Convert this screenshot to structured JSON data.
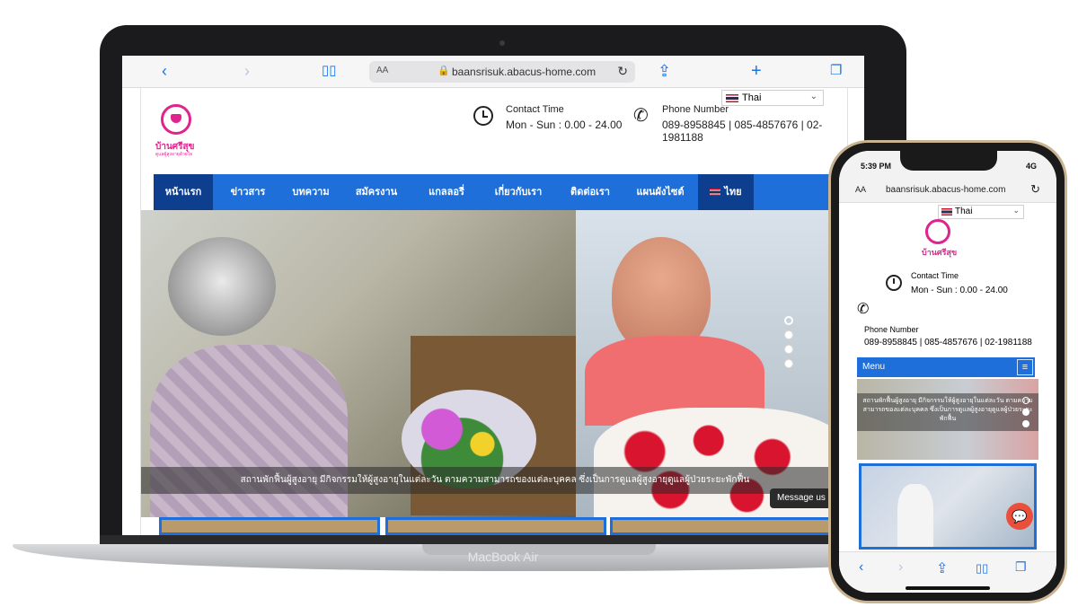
{
  "laptop": {
    "device_label": "MacBook Air",
    "safari": {
      "back_icon": "chevron-left-icon",
      "forward_icon": "chevron-right-icon",
      "bookmarks_icon": "book-icon",
      "text_size": "AA",
      "url": "baansrisuk.abacus-home.com",
      "share_icon": "share-icon",
      "new_tab_icon": "plus-icon",
      "tabs_icon": "tabs-icon"
    },
    "site": {
      "language": "Thai",
      "logo_text": "บ้านศรีสุข",
      "logo_subtext": "ดูแลผู้สูงอายุด้วยใจ",
      "contact_title": "Contact Time",
      "contact_value": "Mon - Sun : 0.00 - 24.00",
      "phone_title": "Phone Number",
      "phone_value": "089-8958845 | 085-4857676 | 02-1981188",
      "nav": [
        "หน้าแรก",
        "ข่าวสาร",
        "บทความ",
        "สมัครงาน",
        "แกลลอรี่",
        "เกี่ยวกับเรา",
        "ติดต่อเรา",
        "แผนผังไซต์",
        "ไทย"
      ],
      "hero_caption": "สถานพักฟื้นผู้สูงอายุ มีกิจกรรมให้ผู้สูงอายุในแต่ละวัน ตามความสามารถของแต่ละบุคคล ซึ่งเป็นการดูแลผู้สูงอายุดูแลผู้ป่วยระยะพักฟื้น",
      "message_button": "Message us"
    }
  },
  "phone": {
    "time": "5:39 PM",
    "signal": "4G",
    "text_size": "AA",
    "url": "baansrisuk.abacus-home.com",
    "language": "Thai",
    "logo_text": "บ้านศรีสุข",
    "contact_title": "Contact Time",
    "contact_value": "Mon - Sun : 0.00 - 24.00",
    "phone_title": "Phone Number",
    "phone_value": "089-8958845 | 085-4857676 | 02-1981188",
    "menu_label": "Menu",
    "hero_caption": "สถานพักฟื้นผู้สูงอายุ มีกิจกรรมให้ผู้สูงอายุในแต่ละวัน ตามความสามารถของแต่ละบุคคล ซึ่งเป็นการดูแลผู้สูงอายุดูแลผู้ป่วยระยะพักฟื้น",
    "colors": {
      "accent": "#1e6fd9",
      "brand": "#e0248e",
      "chat": "#ea4f3b"
    }
  }
}
